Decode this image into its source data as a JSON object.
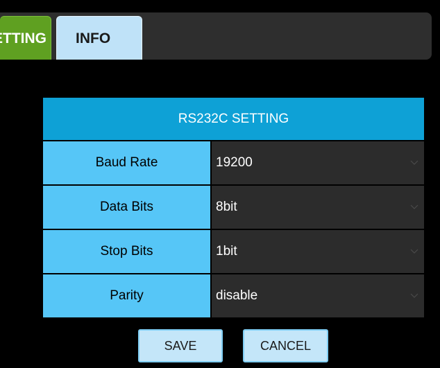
{
  "tabs": {
    "setting_label": "SETTING",
    "info_label": "INFO",
    "active": "SETTING"
  },
  "panel": {
    "title": "RS232C SETTING",
    "rows": [
      {
        "label": "Baud Rate",
        "value": "19200"
      },
      {
        "label": "Data Bits",
        "value": "8bit"
      },
      {
        "label": "Stop Bits",
        "value": "1bit"
      },
      {
        "label": "Parity",
        "value": "disable"
      }
    ]
  },
  "buttons": {
    "save_label": "SAVE",
    "cancel_label": "CANCEL"
  },
  "colors": {
    "background": "#000000",
    "tab_active": "#5fa021",
    "tab_inactive": "#bfe2f8",
    "panel_header": "#0ea1d6",
    "label_cell": "#56c6f7",
    "value_cell": "#2c2c2c",
    "button": "#c4e6f9"
  },
  "icons": {
    "select_arrow": "chevron-down-icon"
  }
}
